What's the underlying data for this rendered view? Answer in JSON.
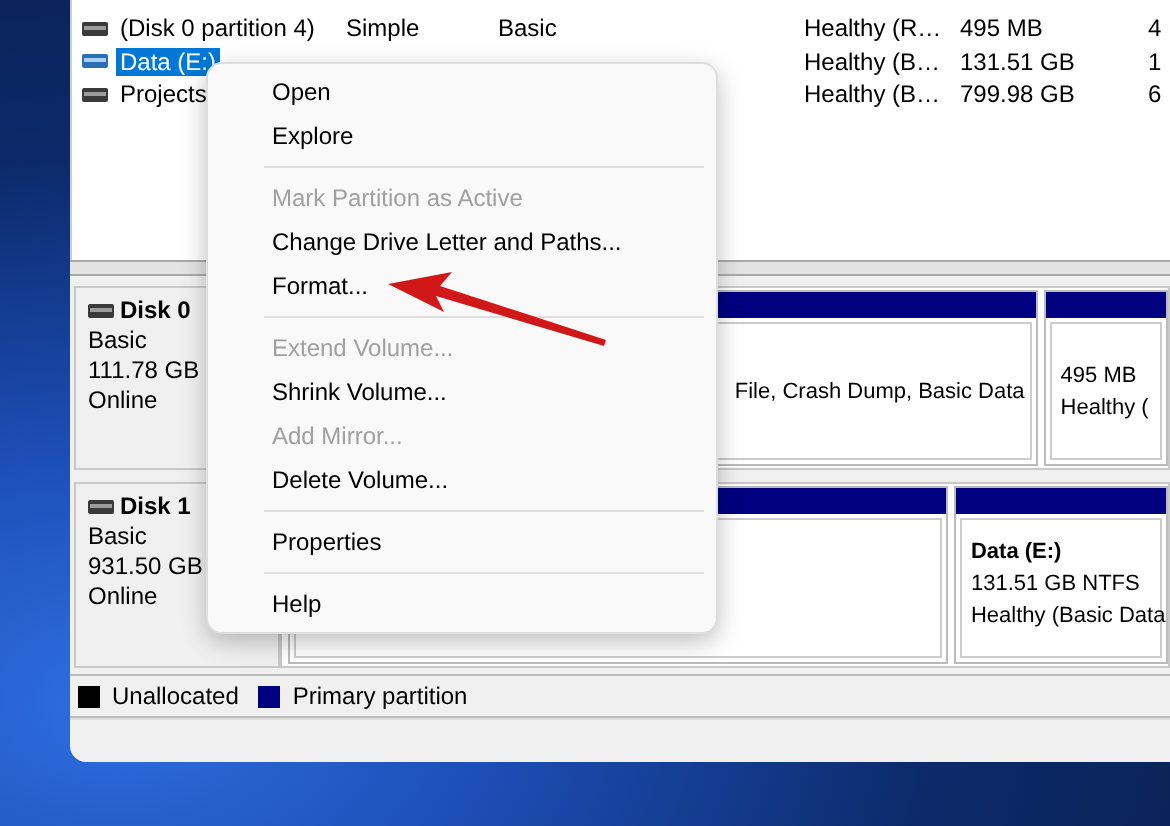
{
  "volumes": [
    {
      "name": "(Disk 0 partition 4)",
      "selected": false,
      "cells": [
        "Simple",
        "Basic",
        "",
        "Healthy (R…",
        "495 MB",
        "4"
      ]
    },
    {
      "name": "Data (E:)",
      "selected": true,
      "cells": [
        "",
        "",
        "",
        "Healthy (B…",
        "131.51 GB",
        "1"
      ]
    },
    {
      "name": "Projects",
      "selected": false,
      "cells": [
        "",
        "",
        "",
        "Healthy (B…",
        "799.98 GB",
        "6"
      ]
    }
  ],
  "disks": [
    {
      "name": "Disk 0",
      "type": "Basic",
      "size": "111.78 GB",
      "status": "Online",
      "partitions": [
        {
          "kind": "volume",
          "lines": [
            "File, Crash Dump, Basic Data"
          ]
        },
        {
          "kind": "volume",
          "lines": [
            "495 MB",
            "Healthy ("
          ]
        }
      ]
    },
    {
      "name": "Disk 1",
      "type": "Basic",
      "size": "931.50 GB",
      "status": "Online",
      "partitions": [
        {
          "kind": "covered"
        },
        {
          "kind": "volume",
          "title": "Data  (E:)",
          "lines": [
            "131.51 GB NTFS",
            "Healthy (Basic Data"
          ]
        }
      ]
    }
  ],
  "legend": [
    {
      "label": "Unallocated",
      "color": "#000000"
    },
    {
      "label": "Primary partition",
      "color": "#000080"
    }
  ],
  "context_menu": [
    {
      "kind": "item",
      "label": "Open",
      "disabled": false
    },
    {
      "kind": "item",
      "label": "Explore",
      "disabled": false
    },
    {
      "kind": "separator"
    },
    {
      "kind": "item",
      "label": "Mark Partition as Active",
      "disabled": true
    },
    {
      "kind": "item",
      "label": "Change Drive Letter and Paths...",
      "disabled": false
    },
    {
      "kind": "item",
      "label": "Format...",
      "disabled": false
    },
    {
      "kind": "separator"
    },
    {
      "kind": "item",
      "label": "Extend Volume...",
      "disabled": true
    },
    {
      "kind": "item",
      "label": "Shrink Volume...",
      "disabled": false
    },
    {
      "kind": "item",
      "label": "Add Mirror...",
      "disabled": true
    },
    {
      "kind": "item",
      "label": "Delete Volume...",
      "disabled": false
    },
    {
      "kind": "separator"
    },
    {
      "kind": "item",
      "label": "Properties",
      "disabled": false
    },
    {
      "kind": "separator"
    },
    {
      "kind": "item",
      "label": "Help",
      "disabled": false
    }
  ]
}
